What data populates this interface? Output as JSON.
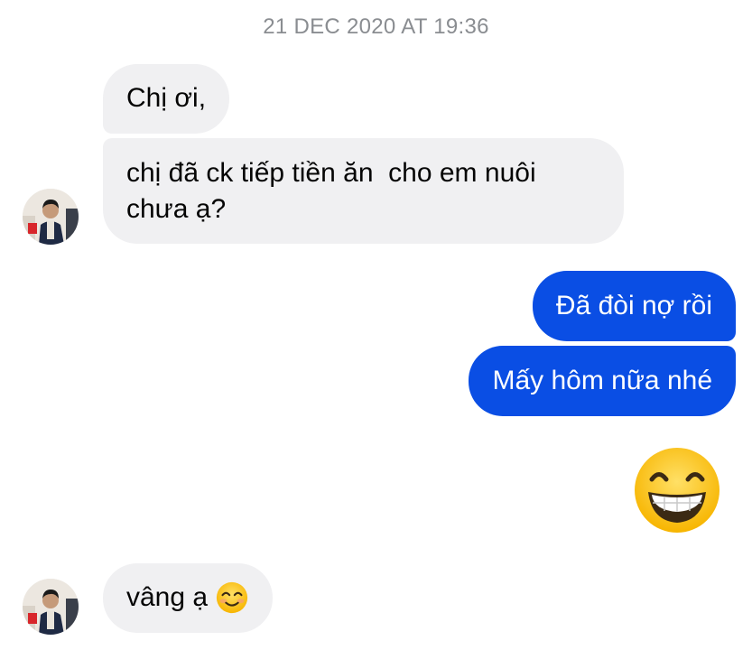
{
  "conversation": {
    "timestamp": "21 DEC 2020 AT 19:36",
    "messages": [
      {
        "sender": "them",
        "text": "Chị ơi,"
      },
      {
        "sender": "them",
        "text": "chị đã ck tiếp tiền ăn  cho em nuôi chưa ạ?"
      },
      {
        "sender": "me",
        "text": "Đã đòi nợ rồi"
      },
      {
        "sender": "me",
        "text": "Mấy hôm nữa nhé"
      },
      {
        "sender": "me",
        "emoji": "grinning-face-with-smiling-eyes"
      },
      {
        "sender": "them",
        "text": "vâng ạ",
        "emoji": "smiling-face-with-smiling-eyes"
      }
    ]
  },
  "colors": {
    "outgoing_bubble": "#0a4ee4",
    "incoming_bubble": "#f0f0f2",
    "timestamp_text": "#8a8d91"
  },
  "icons": {
    "contact_avatar": "avatar-photo",
    "big_emoji": "grinning-face-with-smiling-eyes",
    "inline_emoji": "smiling-face-with-smiling-eyes"
  }
}
